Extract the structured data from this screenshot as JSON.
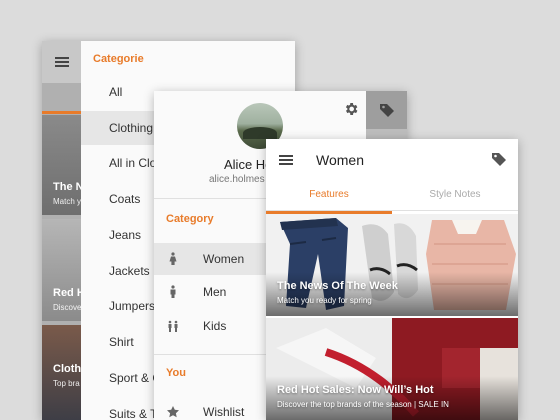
{
  "panel_back": {
    "section_label": "Categorie",
    "items": [
      "All",
      "Clothing",
      "All in Clot",
      "Coats",
      "Jeans",
      "Jackets",
      "Jumpers",
      "Shirt",
      "Sport & C",
      "Suits & T"
    ],
    "selected_index": 1,
    "thumbs": [
      {
        "title": "The N",
        "subtitle": "Match y"
      },
      {
        "title": "Red H",
        "subtitle": "Discove"
      },
      {
        "title": "Clothi",
        "subtitle": "Top bra"
      }
    ]
  },
  "panel_mid": {
    "name": "Alice Ho",
    "email": "alice.holmes",
    "category_label": "Category",
    "nav": [
      {
        "label": "Women",
        "icon": "woman-icon"
      },
      {
        "label": "Men",
        "icon": "man-icon"
      },
      {
        "label": "Kids",
        "icon": "kids-icon"
      }
    ],
    "selected_index": 0,
    "you_label": "You",
    "you_items": [
      {
        "label": "Wishlist",
        "icon": "star-icon"
      }
    ]
  },
  "panel_front": {
    "title": "Women",
    "tabs": [
      "Features",
      "Style Notes"
    ],
    "active_tab": 0,
    "cards": [
      {
        "title": "The News Of The Week",
        "subtitle": "Match you ready for spring"
      },
      {
        "title": "Red Hot Sales: Now Will’s Hot",
        "subtitle": "Discover the top brands of the season | SALE IN"
      }
    ]
  },
  "colors": {
    "accent": "#e87b2a",
    "background": "#dcdcdc"
  }
}
